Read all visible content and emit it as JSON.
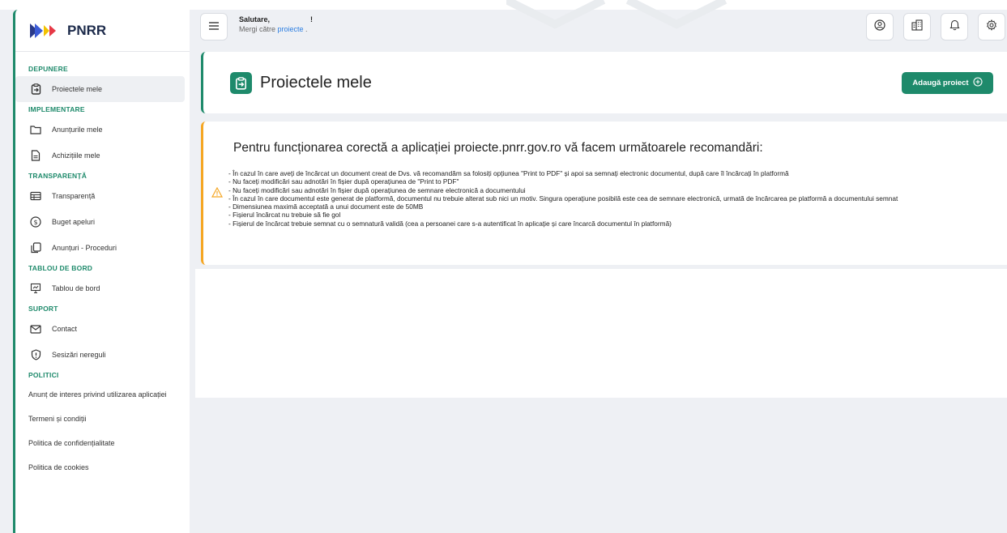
{
  "app": {
    "logo_text": "PNRR",
    "accent_color": "#1e8a6b",
    "warning_color": "#f5a623"
  },
  "header": {
    "greeting": "Salutare,                    !",
    "goto_prefix": "Mergi către ",
    "goto_link": "proiecte",
    "goto_suffix": " .",
    "buttons": [
      {
        "name": "user-icon"
      },
      {
        "name": "building-icon"
      },
      {
        "name": "bell-icon"
      },
      {
        "name": "gear-icon"
      }
    ]
  },
  "sidebar": {
    "sections": {
      "depunere": "DEPUNERE",
      "implementare": "IMPLEMENTARE",
      "transparenta": "TRANSPARENȚĂ",
      "tablou": "TABLOU DE BORD",
      "suport": "SUPORT",
      "politici": "POLITICI"
    },
    "items": {
      "proiectele_mele": "Proiectele mele",
      "anunturile_mele": "Anunțurile mele",
      "achizitiile_mele": "Achizițiile mele",
      "transparenta": "Transparență",
      "buget_apeluri": "Buget apeluri",
      "anunturi_proceduri": "Anunțuri - Proceduri",
      "tablou_de_bord": "Tablou de bord",
      "contact": "Contact",
      "sesizari": "Sesizări nereguli",
      "anunt_interes": "Anunț de interes privind utilizarea aplicației",
      "termeni": "Termeni și condiții",
      "confidentialitate": "Politica de confidențialitate",
      "cookies": "Politica de cookies"
    }
  },
  "main": {
    "title": "Proiectele mele",
    "add_button": "Adaugă proiect",
    "alert": {
      "title": "Pentru funcționarea corectă a aplicației proiecte.pnrr.gov.ro vă facem următoarele recomandări:",
      "lines": [
        "- În cazul în care aveți de încărcat un document creat de Dvs. vă recomandăm sa folosiți opțiunea \"Print to PDF\" și apoi sa semnați electronic documentul, după care îl încărcați în platformă",
        "- Nu faceți modificări sau adnotări în fișier după operațiunea de \"Print to PDF\"",
        "- Nu faceți modificări sau adnotări în fișier după operațiunea de semnare electronică a documentului",
        "- În cazul în care documentul este generat de platformă, documentul nu trebuie alterat sub nici un motiv. Singura operațiune posibilă este cea de semnare electronică, urmată de încărcarea pe platformă a documentului semnat",
        "- Dimensiunea maximă acceptată a unui document este de 50MB",
        "- Fișierul încărcat nu trebuie să fie gol",
        "- Fișierul de încărcat trebuie semnat cu o semnatură validă (cea a persoanei care s-a autentificat în aplicație și care încarcă documentul în platformă)"
      ]
    }
  }
}
